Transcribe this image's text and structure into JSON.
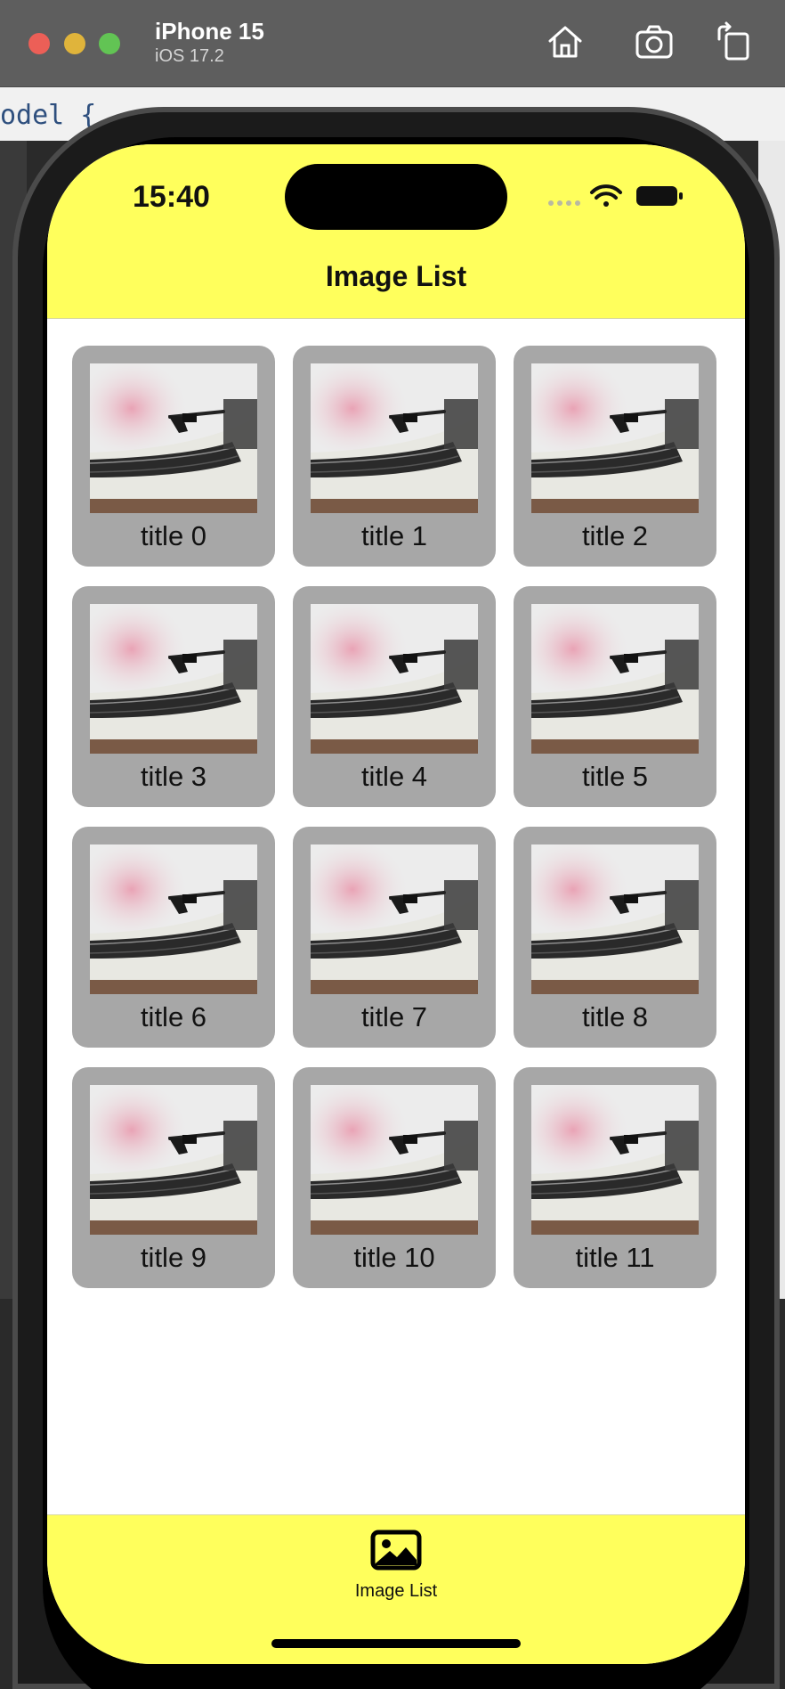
{
  "window": {
    "device_name": "iPhone 15",
    "os_version": "iOS 17.2",
    "buttons": [
      "home-icon",
      "screenshot-icon",
      "rotate-icon"
    ],
    "background_code": "odel {"
  },
  "status_bar": {
    "time": "15:40",
    "icons": [
      "cellular-icon",
      "wifi-icon",
      "battery-icon"
    ]
  },
  "navigation": {
    "title": "Image List"
  },
  "grid": {
    "items": [
      {
        "title": "title 0"
      },
      {
        "title": "title 1"
      },
      {
        "title": "title 2"
      },
      {
        "title": "title 3"
      },
      {
        "title": "title 4"
      },
      {
        "title": "title 5"
      },
      {
        "title": "title 6"
      },
      {
        "title": "title 7"
      },
      {
        "title": "title 8"
      },
      {
        "title": "title 9"
      },
      {
        "title": "title 10"
      },
      {
        "title": "title 11"
      }
    ]
  },
  "tab_bar": {
    "items": [
      {
        "label": "Image List",
        "icon": "photo-icon",
        "selected": true
      }
    ]
  },
  "colors": {
    "bar_background": "#ffff5c",
    "card_background": "#a7a7a7"
  }
}
